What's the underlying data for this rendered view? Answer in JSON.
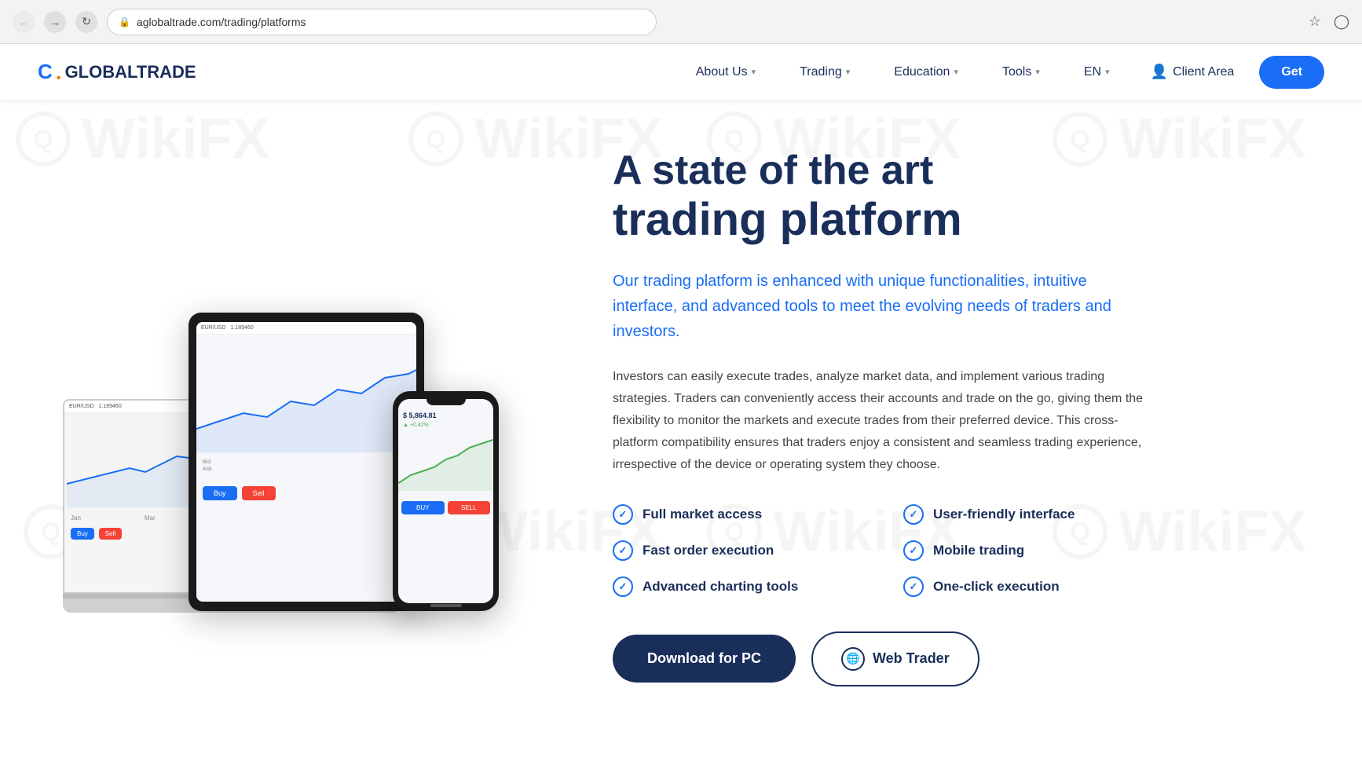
{
  "browser": {
    "url": "aglobaltrade.com/trading/platforms",
    "back_disabled": true,
    "forward_disabled": true
  },
  "navbar": {
    "logo_text": "C. GLOBALTRADE",
    "nav_items": [
      {
        "label": "About Us",
        "has_dropdown": true
      },
      {
        "label": "Trading",
        "has_dropdown": true
      },
      {
        "label": "Education",
        "has_dropdown": true
      },
      {
        "label": "Tools",
        "has_dropdown": true
      },
      {
        "label": "EN",
        "has_dropdown": true
      }
    ],
    "client_area_label": "Client Area",
    "cta_button_label": "Get"
  },
  "hero": {
    "title_top": "A state of the art",
    "title_main": "trading platform",
    "subtitle": "Our trading platform is enhanced with unique functionalities, intuitive interface, and advanced tools to meet the evolving needs of traders and investors.",
    "body": "Investors can easily execute trades, analyze market data, and implement various trading strategies. Traders can conveniently access their accounts and trade on the go, giving them the flexibility to monitor the markets and execute trades from their preferred device. This cross-platform compatibility ensures that traders enjoy a consistent and seamless trading experience, irrespective of the device or operating system they choose.",
    "features": [
      {
        "label": "Full market access"
      },
      {
        "label": "User-friendly interface"
      },
      {
        "label": "Fast order execution"
      },
      {
        "label": "Mobile trading"
      },
      {
        "label": "Advanced charting tools"
      },
      {
        "label": "One-click execution"
      }
    ],
    "btn_download_label": "Download for PC",
    "btn_web_trader_label": "Web Trader"
  },
  "watermarks": [
    {
      "text": "WikiFX"
    },
    {
      "text": "WikiFX"
    },
    {
      "text": "WikiFX"
    },
    {
      "text": "WikiFX"
    }
  ],
  "devices": {
    "laptop_currency": "EUR/USD",
    "laptop_price": "1.189460",
    "tablet_currency": "EUR/USD",
    "tablet_price": "1.189460",
    "phone_price": "$ 5,864.81"
  }
}
